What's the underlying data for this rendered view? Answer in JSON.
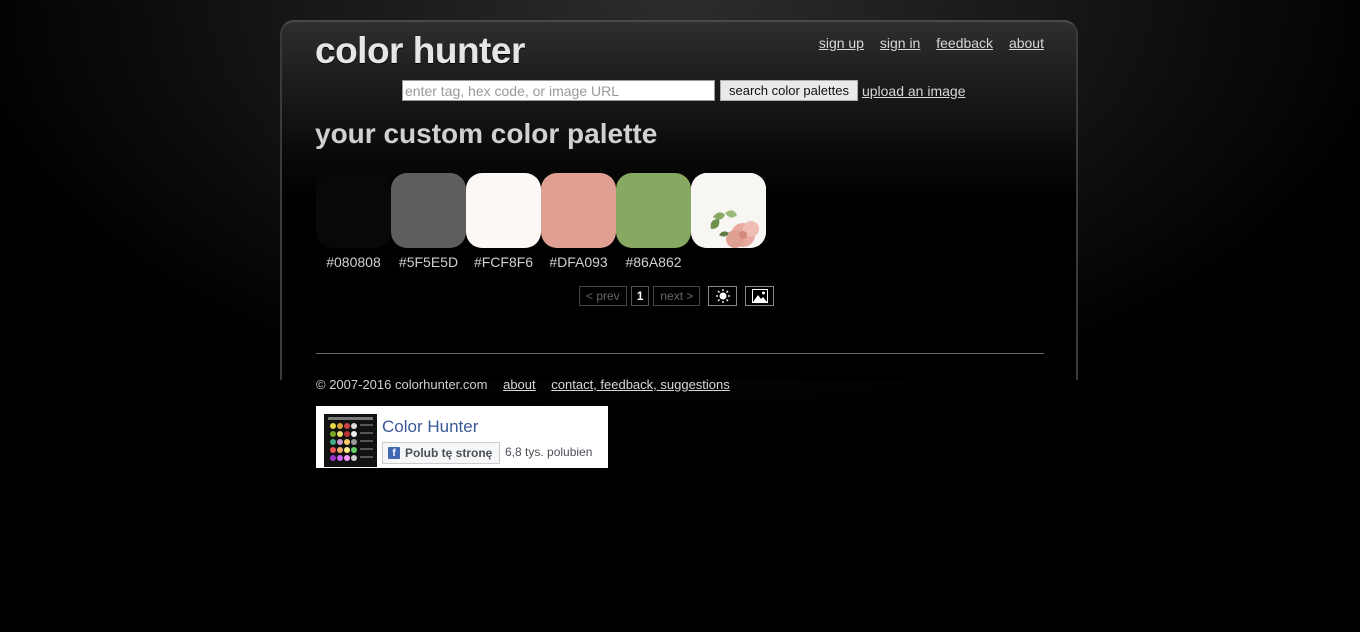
{
  "site": {
    "logo": "color hunter"
  },
  "topnav": [
    {
      "label": "sign up"
    },
    {
      "label": "sign in"
    },
    {
      "label": "feedback"
    },
    {
      "label": "about"
    }
  ],
  "search": {
    "placeholder": "enter tag, hex code, or image URL",
    "value": "",
    "button_label": "search color palettes",
    "upload_label": "upload an image"
  },
  "page_title": "your custom color palette",
  "palette": [
    {
      "hex": "#080808",
      "color": "#080808"
    },
    {
      "hex": "#5F5E5D",
      "color": "#5F5E5D"
    },
    {
      "hex": "#FCF8F6",
      "color": "#FCF8F6"
    },
    {
      "hex": "#DFA093",
      "color": "#DFA093"
    },
    {
      "hex": "#86A862",
      "color": "#86A862"
    }
  ],
  "pager": {
    "prev_label": "< prev",
    "current_page": "1",
    "next_label": "next >",
    "icons": [
      "brightness-icon",
      "image-icon"
    ]
  },
  "footer": {
    "copyright": "© 2007-2016 colorhunter.com",
    "about_label": "about",
    "contact_label": "contact, feedback, suggestions"
  },
  "facebook": {
    "page_name": "Color Hunter",
    "like_label": "Polub tę stronę",
    "like_count": "6,8 tys. polubien",
    "brand_color": "#3b5998"
  }
}
